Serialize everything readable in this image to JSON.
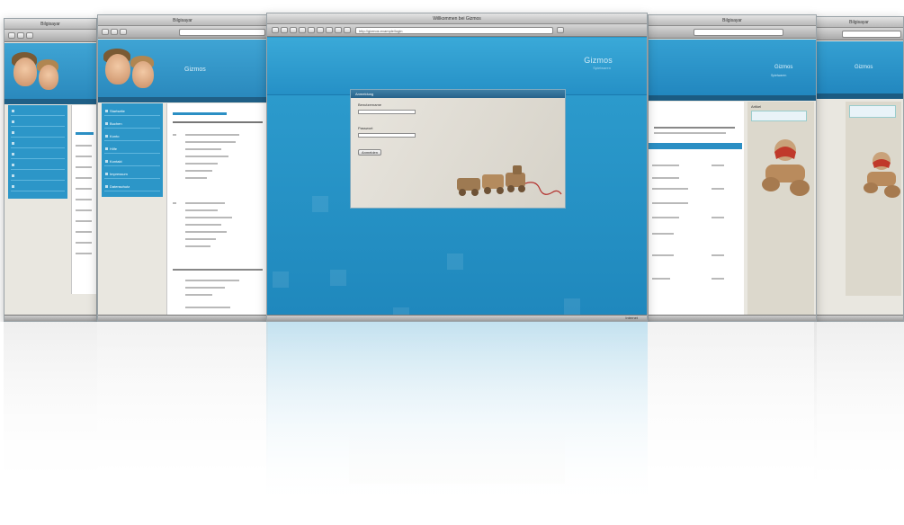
{
  "windows": {
    "far_left": {
      "title": "Bilgisayar"
    },
    "mid_left": {
      "title": "Bilgisayar",
      "page_heading": "Gizmos",
      "nav_items": [
        "Startseite",
        "Buchen",
        "Konto",
        "Hilfe",
        "Kontakt",
        "Impressum",
        "Datenschutz"
      ]
    },
    "center": {
      "title": "Willkommen bei Gizmos",
      "address": "http://gizmos.example/login",
      "brand": "Gizmos",
      "brand_sub": "Spielwaren",
      "login_box": {
        "header": "Anmeldung",
        "username_label": "Benutzername",
        "password_label": "Passwort",
        "submit_label": "Anmelden"
      },
      "status_right": "Internet"
    },
    "mid_right": {
      "title": "Bilgisayar",
      "header_title": "Gizmos",
      "header_sub": "Spielwaren",
      "sidebar_heading": "Artikel"
    },
    "far_right": {
      "title": "Bilgisayar",
      "header_title": "Gizmos"
    }
  },
  "colors": {
    "accent": "#2a96c8",
    "dark_band": "#1f5f86",
    "login_bg": "#e2ded5"
  }
}
